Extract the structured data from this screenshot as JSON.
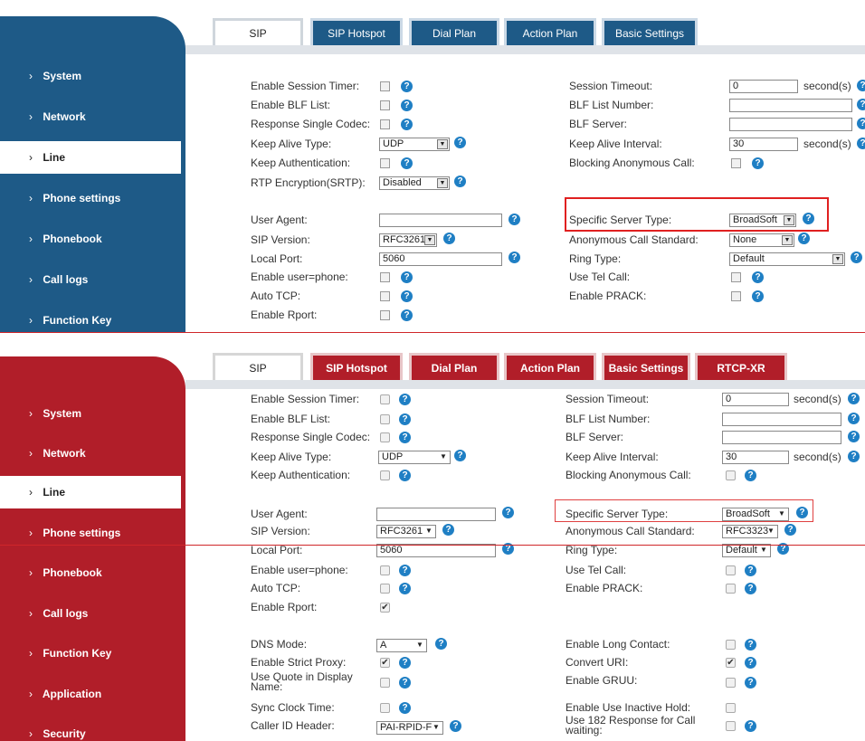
{
  "top": {
    "tabs": [
      "SIP",
      "SIP Hotspot",
      "Dial Plan",
      "Action Plan",
      "Basic Settings"
    ],
    "nav": [
      "System",
      "Network",
      "Line",
      "Phone settings",
      "Phonebook",
      "Call logs",
      "Function Key"
    ],
    "active_nav": "Line",
    "left_labels": [
      "Enable Session Timer:",
      "Enable BLF List:",
      "Response Single Codec:",
      "Keep Alive Type:",
      "Keep Authentication:",
      "RTP Encryption(SRTP):",
      "User Agent:",
      "SIP Version:",
      "Local Port:",
      "Enable user=phone:",
      "Auto TCP:",
      "Enable Rport:"
    ],
    "right_labels": [
      "Session Timeout:",
      "BLF List Number:",
      "BLF Server:",
      "Keep Alive Interval:",
      "Blocking Anonymous Call:",
      "Specific Server Type:",
      "Anonymous Call Standard:",
      "Ring Type:",
      "Use Tel Call:",
      "Enable PRACK:"
    ],
    "keep_alive_type": "UDP",
    "rtp_encryption": "Disabled",
    "sip_version": "RFC3261",
    "local_port": "5060",
    "session_timeout": "0",
    "keep_alive_interval": "30",
    "unit": "second(s)",
    "specific_server_type": "BroadSoft",
    "anonymous_call_standard": "None",
    "ring_type": "Default"
  },
  "bottom": {
    "tabs": [
      "SIP",
      "SIP Hotspot",
      "Dial Plan",
      "Action Plan",
      "Basic Settings",
      "RTCP-XR"
    ],
    "nav": [
      "System",
      "Network",
      "Line",
      "Phone settings",
      "Phonebook",
      "Call logs",
      "Function Key",
      "Application",
      "Security"
    ],
    "active_nav": "Line",
    "left_labels": [
      "Enable Session Timer:",
      "Enable BLF List:",
      "Response Single Codec:",
      "Keep Alive Type:",
      "Keep Authentication:",
      "User Agent:",
      "SIP Version:",
      "Local Port:",
      "Enable user=phone:",
      "Auto TCP:",
      "Enable Rport:",
      "DNS Mode:",
      "Enable Strict Proxy:",
      "Use Quote in Display Name:",
      "Sync Clock Time:",
      "Caller ID Header:"
    ],
    "right_labels": [
      "Session Timeout:",
      "BLF List Number:",
      "BLF Server:",
      "Keep Alive Interval:",
      "Blocking Anonymous Call:",
      "Specific Server Type:",
      "Anonymous Call Standard:",
      "Ring Type:",
      "Use Tel Call:",
      "Enable PRACK:",
      "Enable Long Contact:",
      "Convert URI:",
      "Enable GRUU:",
      "Enable Use Inactive Hold:",
      "Use 182 Response for Call waiting:"
    ],
    "keep_alive_type": "UDP",
    "sip_version": "RFC3261",
    "local_port": "5060",
    "session_timeout": "0",
    "keep_alive_interval": "30",
    "unit": "second(s)",
    "specific_server_type": "BroadSoft",
    "anonymous_call_standard": "RFC3323",
    "ring_type": "Default",
    "dns_mode": "A",
    "caller_id_header": "PAI-RPID-F",
    "checked_left": [
      "Enable Rport:",
      "Enable Strict Proxy:"
    ],
    "checked_right": [
      "Convert URI:"
    ]
  },
  "icons": {
    "help": "help-icon",
    "chevron": "chevron-right-icon",
    "checkmark": "✔"
  },
  "colors": {
    "top_theme": "#1e5a87",
    "bottom_theme": "#b11e29",
    "help": "#1f7fc4",
    "highlight": "#e02020"
  }
}
